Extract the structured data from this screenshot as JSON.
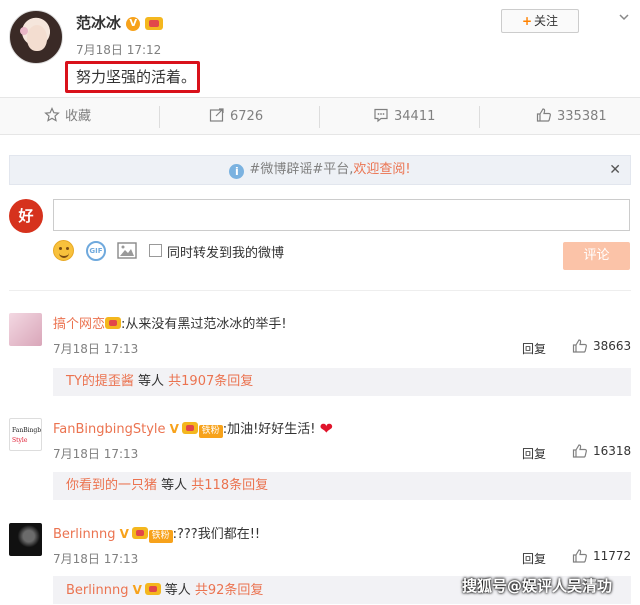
{
  "post": {
    "author": "范冰冰",
    "time": "7月18日 17:12",
    "text": "努力坚强的活着。",
    "follow_label": "关注"
  },
  "actions": {
    "favorite_label": "收藏",
    "repost_count": "6726",
    "comment_count": "34411",
    "like_count": "335381"
  },
  "rumor_bar": {
    "text": "#微博辟谣#平台,",
    "link": "欢迎查阅!"
  },
  "composer": {
    "avatar_text": "好",
    "gif_label": "GIF",
    "repost_checkbox_label": "同时转发到我的微博",
    "submit_label": "评论"
  },
  "comments": [
    {
      "name": "搞个网恋",
      "text": ":从来没有黑过范冰冰的举手!",
      "time": "7月18日 17:13",
      "reply_label": "回复",
      "likes": "38663",
      "sub": {
        "name": "TY的提歪酱",
        "middle": " 等人 ",
        "count": "共1907条回复"
      }
    },
    {
      "name": "FanBingbingStyle",
      "fan_badge": "铁粉",
      "text": ":加油!好好生活!",
      "time": "7月18日 17:13",
      "reply_label": "回复",
      "likes": "16318",
      "sub": {
        "name": "你看到的一只猪",
        "middle": " 等人 ",
        "count": "共118条回复"
      }
    },
    {
      "name": "Berlinnng",
      "fan_badge": "铁粉",
      "text": ":???我们都在!!",
      "time": "7月18日 17:13",
      "reply_label": "回复",
      "likes": "11772",
      "sub": {
        "name": "Berlinnng",
        "middle": " 等人 ",
        "count": "共92条回复"
      }
    }
  ],
  "watermark": "搜狐号@娱评人吴清功",
  "colors": {
    "accent": "#eb7350",
    "highlight_border": "#d9111b",
    "submit_bg": "#fbc3a8"
  }
}
